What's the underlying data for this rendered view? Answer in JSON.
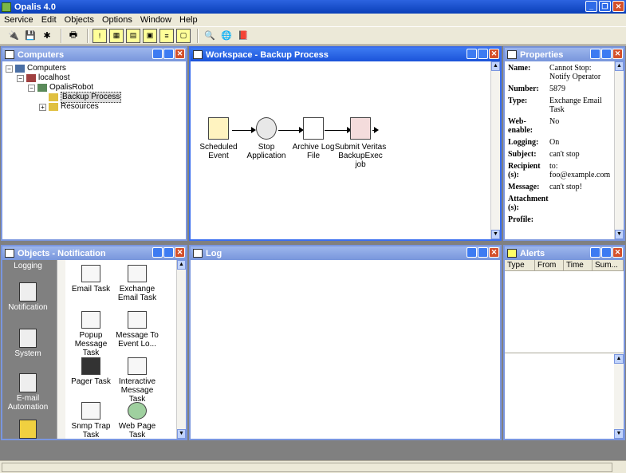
{
  "app": {
    "title": "Opalis 4.0"
  },
  "menu": [
    "Service",
    "Edit",
    "Objects",
    "Options",
    "Window",
    "Help"
  ],
  "computers": {
    "title": "Computers",
    "tree": {
      "root": "Computers",
      "host": "localhost",
      "robot": "OpalisRobot",
      "backup": "Backup Process",
      "resources": "Resources"
    }
  },
  "workspace": {
    "title": "Workspace - Backup Process",
    "nodes": [
      "Scheduled Event",
      "Stop Application",
      "Archive Log File",
      "Submit Veritas BackupExec job"
    ]
  },
  "properties": {
    "title": "Properties",
    "rows": [
      {
        "k": "Name:",
        "v": "Cannot Stop: Notify Operator"
      },
      {
        "k": "Number:",
        "v": "5879"
      },
      {
        "k": "Type:",
        "v": "Exchange Email Task"
      },
      {
        "k": "Web-enable:",
        "v": "No"
      },
      {
        "k": "Logging:",
        "v": "On"
      },
      {
        "k": "Subject:",
        "v": "can't stop"
      },
      {
        "k": "Recipient (s):",
        "v": "to: foo@example.com"
      },
      {
        "k": "Message:",
        "v": "can't stop!"
      },
      {
        "k": "Attachment (s):",
        "v": ""
      },
      {
        "k": "Profile:",
        "v": ""
      }
    ]
  },
  "objects": {
    "title": "Objects - Notification",
    "categories": [
      "Logging",
      "Notification",
      "System",
      "E-mail Automation"
    ],
    "items": [
      "Email Task",
      "Exchange Email Task",
      "Popup Message Task",
      "Message To Event Lo...",
      "Pager Task",
      "Interactive Message Task",
      "Snmp Trap Task",
      "Web Page Task"
    ]
  },
  "log": {
    "title": "Log"
  },
  "alerts": {
    "title": "Alerts",
    "columns": [
      "Type",
      "From",
      "Time",
      "Sum..."
    ]
  }
}
